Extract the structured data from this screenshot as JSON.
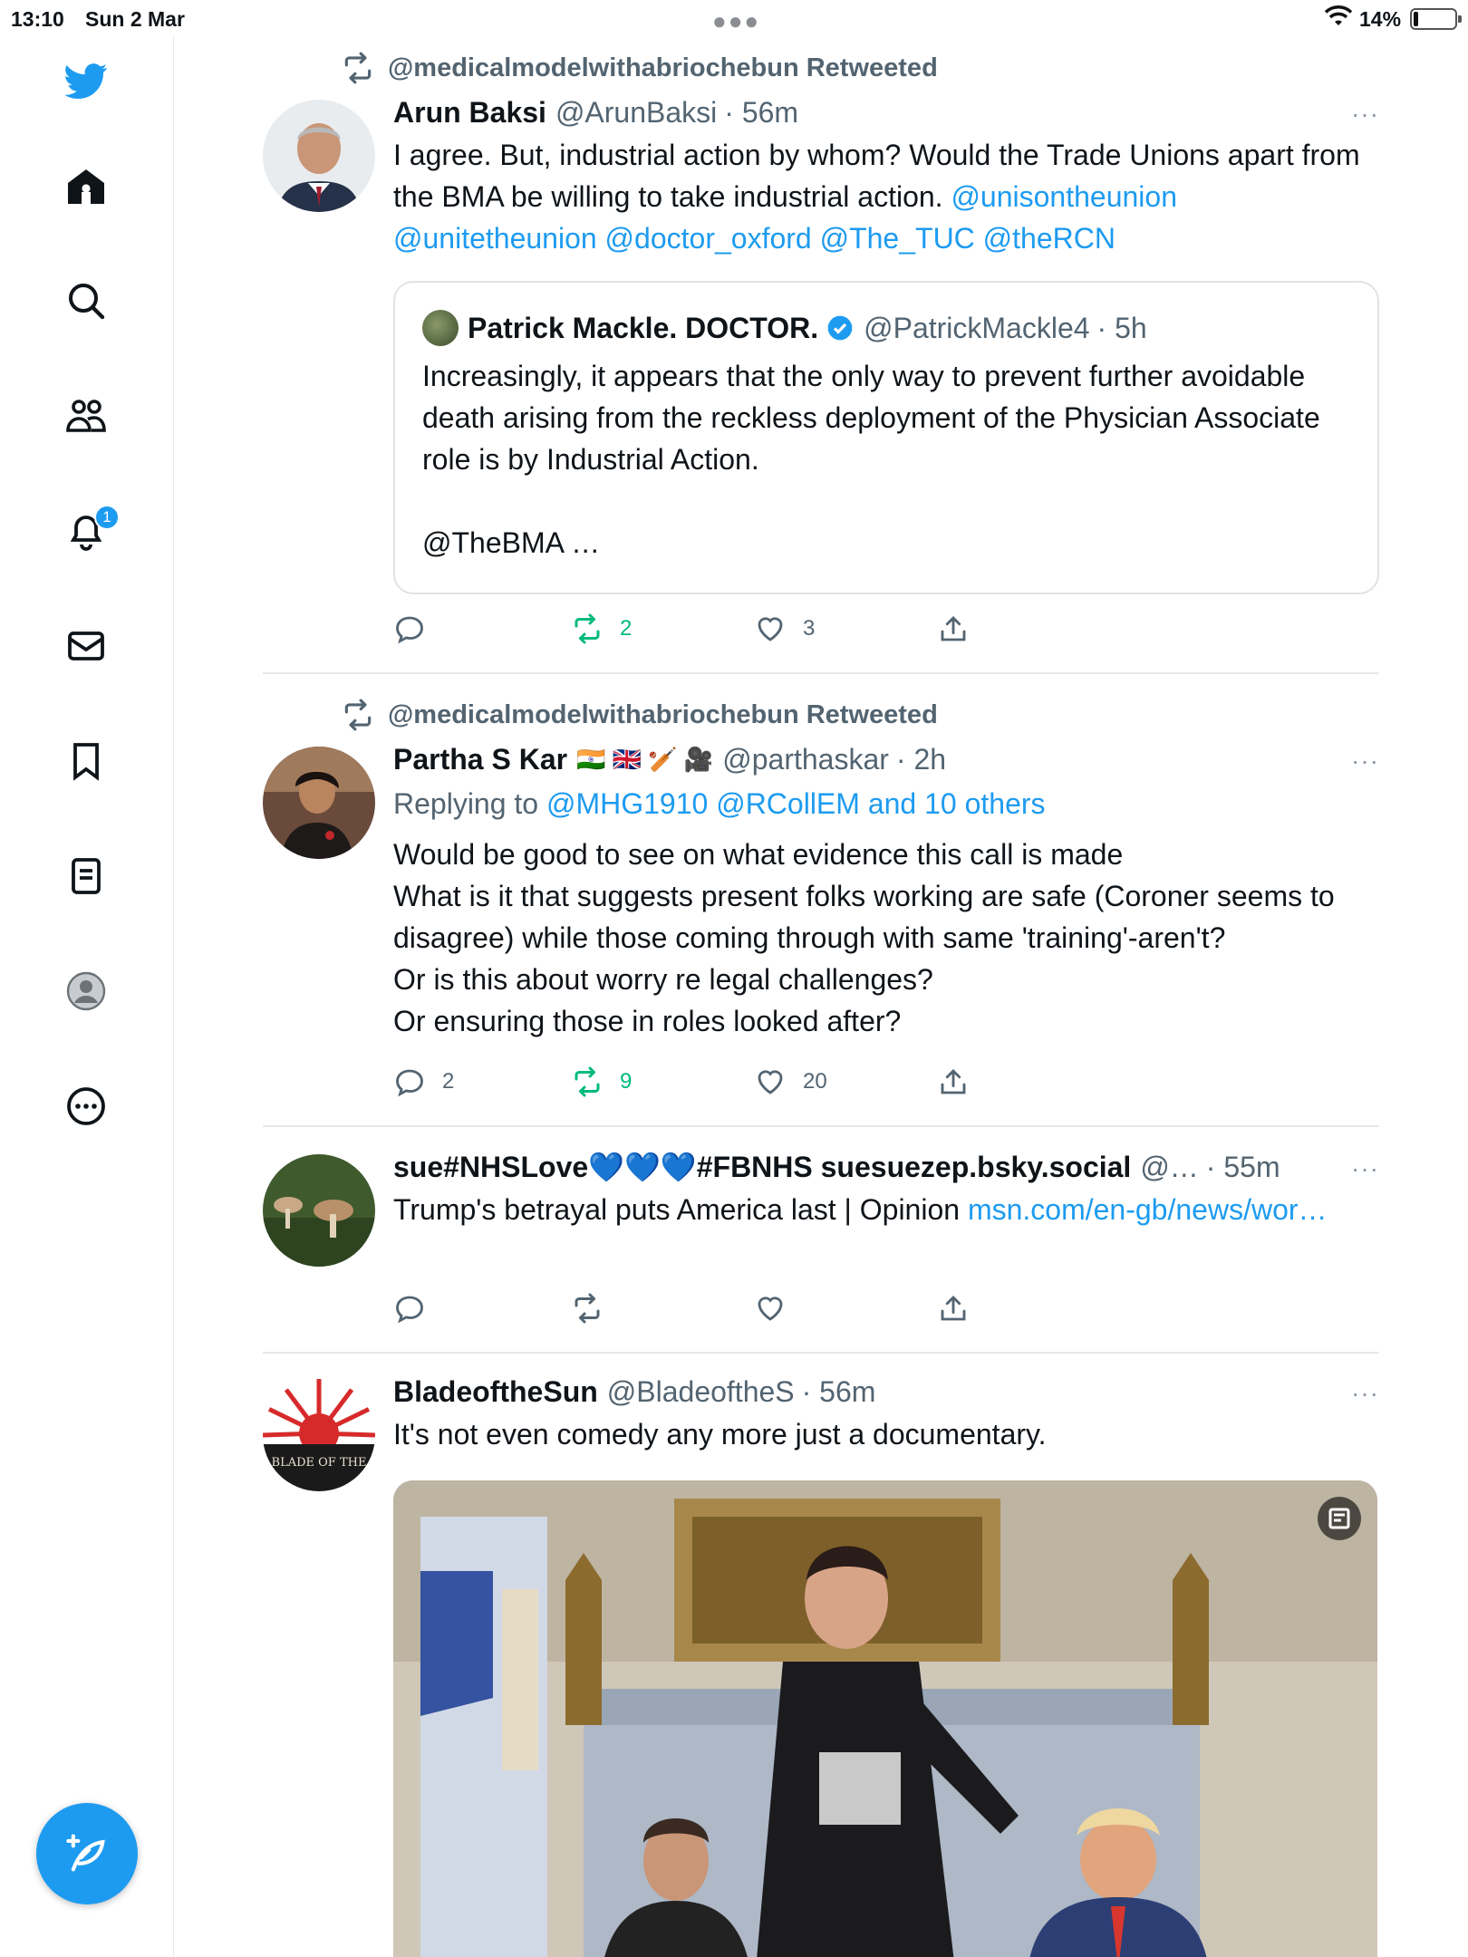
{
  "status_bar": {
    "time": "13:10",
    "date": "Sun 2 Mar",
    "battery": "14%"
  },
  "sidebar": {
    "items": [
      {
        "name": "home"
      },
      {
        "name": "explore"
      },
      {
        "name": "communities"
      },
      {
        "name": "notifications",
        "badge": "1"
      },
      {
        "name": "messages"
      },
      {
        "name": "bookmarks"
      },
      {
        "name": "lists"
      },
      {
        "name": "profile"
      },
      {
        "name": "more"
      }
    ],
    "accent_color": "#1d9bf0"
  },
  "tweets": [
    {
      "retweeted_by": "@medicalmodelwithabriochebun Retweeted",
      "name": "Arun Baksi",
      "handle": "@ArunBaksi",
      "time": "· 56m",
      "text": "I agree. But, industrial action by whom? Would the Trade Unions apart from the BMA be willing to take industrial action.",
      "links_line1": "@unisontheunion",
      "links_line2": "@unitetheunion @doctor_oxford @The_TUC @theRCN",
      "quote": {
        "name": "Patrick Mackle. DOCTOR.",
        "handle": "@PatrickMackle4",
        "time": "· 5h",
        "text": "Increasingly, it appears that the only way to prevent further avoidable death arising from the reckless deployment of the Physician Associate role is by Industrial Action.",
        "text2": "@TheBMA …"
      },
      "replies": "",
      "retweets": "2",
      "likes": "3"
    },
    {
      "retweeted_by": "@medicalmodelwithabriochebun Retweeted",
      "name": "Partha S Kar",
      "name_emoji": "🇮🇳 🇬🇧 🏏 🎥",
      "handle": "@parthaskar",
      "time": "· 2h",
      "reply_prefix": "Replying to",
      "reply_targets": "@MHG1910 @RCollEM and 10 others",
      "lines": [
        "Would be good to see on what evidence this call is made",
        "What is it that suggests present folks working are safe (Coroner seems to disagree) while those coming through with same 'training'-aren't?",
        "Or is this about worry re legal challenges?",
        "Or ensuring those in roles looked after?"
      ],
      "replies": "2",
      "retweets": "9",
      "likes": "20"
    },
    {
      "name": "sue#NHSLove💙💙💙#FBNHS suesuezep.bsky.social",
      "handle": "@…",
      "time": "· 55m",
      "text": "Trump's betrayal puts America last | Opinion",
      "link": "msn.com/en-gb/news/wor…",
      "replies": "",
      "retweets": "",
      "likes": ""
    },
    {
      "name": "BladeoftheSun",
      "handle": "@BladeoftheS",
      "time": "· 56m",
      "text": "It's not even comedy any more just a documentary.",
      "avatar_text": "BLADE OF THE"
    }
  ],
  "more_label": "···"
}
